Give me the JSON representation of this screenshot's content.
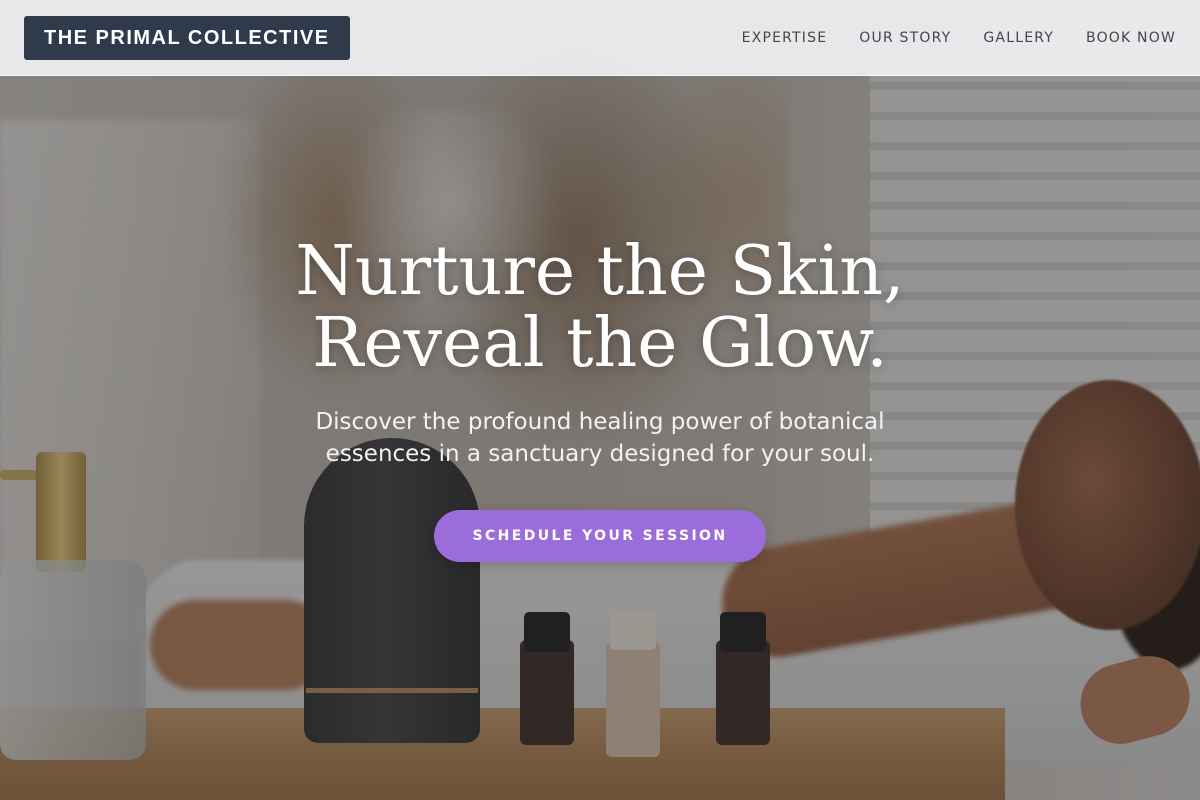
{
  "header": {
    "brand": "THE PRIMAL COLLECTIVE",
    "nav": [
      {
        "label": "EXPERTISE"
      },
      {
        "label": "OUR STORY"
      },
      {
        "label": "GALLERY"
      },
      {
        "label": "BOOK NOW"
      }
    ]
  },
  "hero": {
    "headline_line1": "Nurture the Skin,",
    "headline_line2": "Reveal the Glow.",
    "subtext_line1": "Discover the profound healing power of botanical",
    "subtext_line2": "essences in a sanctuary designed for your soul.",
    "cta_label": "SCHEDULE YOUR SESSION"
  },
  "colors": {
    "brand_background": "#2f3a4b",
    "cta_background": "#9b6ddb",
    "header_background": "#f0f0f2"
  }
}
